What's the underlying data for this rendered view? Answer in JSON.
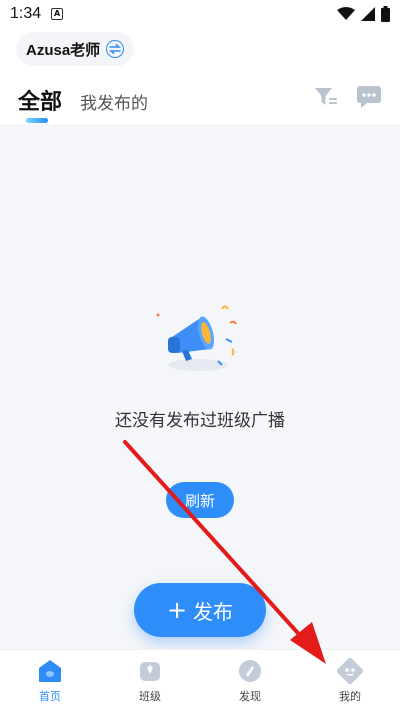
{
  "status_bar": {
    "time": "1:34",
    "notif_icon": "A"
  },
  "header": {
    "teacher_name": "Azusa老师"
  },
  "tabs": [
    {
      "label": "全部",
      "active": true
    },
    {
      "label": "我发布的",
      "active": false
    }
  ],
  "empty_state": {
    "message": "还没有发布过班级广播",
    "refresh_label": "刷新"
  },
  "publish": {
    "plus": "+",
    "label": "发布"
  },
  "bottom_nav": [
    {
      "label": "首页",
      "icon": "home-icon",
      "active": true
    },
    {
      "label": "班级",
      "icon": "class-icon",
      "active": false
    },
    {
      "label": "发现",
      "icon": "discover-icon",
      "active": false
    },
    {
      "label": "我的",
      "icon": "profile-icon",
      "active": false
    }
  ],
  "colors": {
    "accent": "#2f8dfa",
    "background": "#f4f6f9",
    "arrow": "#e31b1b"
  }
}
